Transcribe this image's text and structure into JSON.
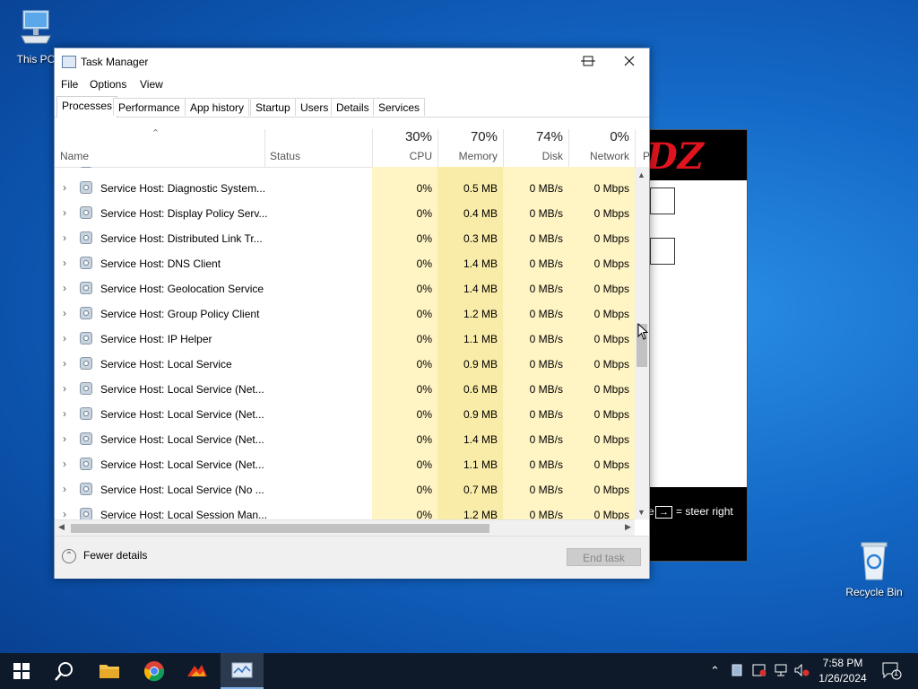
{
  "desktop": {
    "icons": [
      {
        "label": "This PC",
        "icon": "computer-icon"
      },
      {
        "label": "Recycle Bin",
        "icon": "recycle-bin-icon"
      }
    ]
  },
  "background_window": {
    "logo_text": "DZ",
    "hint_key": "→",
    "hint_text": "= steer right",
    "fragment": "e"
  },
  "task_manager": {
    "title": "Task Manager",
    "menu": [
      "File",
      "Options",
      "View"
    ],
    "tabs": [
      "Processes",
      "Performance",
      "App history",
      "Startup",
      "Users",
      "Details",
      "Services"
    ],
    "active_tab": "Processes",
    "columns": {
      "name": "Name",
      "status": "Status",
      "cpu": {
        "pct": "30%",
        "label": "CPU"
      },
      "memory": {
        "pct": "70%",
        "label": "Memory"
      },
      "disk": {
        "pct": "74%",
        "label": "Disk"
      },
      "network": {
        "pct": "0%",
        "label": "Network"
      },
      "power": "P"
    },
    "rows": [
      {
        "name": "Service Host: Diagnostic System...",
        "cpu": "0%",
        "memory": "0.5 MB",
        "disk": "0 MB/s",
        "network": "0 Mbps"
      },
      {
        "name": "Service Host: Display Policy Serv...",
        "cpu": "0%",
        "memory": "0.4 MB",
        "disk": "0 MB/s",
        "network": "0 Mbps"
      },
      {
        "name": "Service Host: Distributed Link Tr...",
        "cpu": "0%",
        "memory": "0.3 MB",
        "disk": "0 MB/s",
        "network": "0 Mbps"
      },
      {
        "name": "Service Host: DNS Client",
        "cpu": "0%",
        "memory": "1.4 MB",
        "disk": "0 MB/s",
        "network": "0 Mbps"
      },
      {
        "name": "Service Host: Geolocation Service",
        "cpu": "0%",
        "memory": "1.4 MB",
        "disk": "0 MB/s",
        "network": "0 Mbps"
      },
      {
        "name": "Service Host: Group Policy Client",
        "cpu": "0%",
        "memory": "1.2 MB",
        "disk": "0 MB/s",
        "network": "0 Mbps"
      },
      {
        "name": "Service Host: IP Helper",
        "cpu": "0%",
        "memory": "1.1 MB",
        "disk": "0 MB/s",
        "network": "0 Mbps"
      },
      {
        "name": "Service Host: Local Service",
        "cpu": "0%",
        "memory": "0.9 MB",
        "disk": "0 MB/s",
        "network": "0 Mbps"
      },
      {
        "name": "Service Host: Local Service (Net...",
        "cpu": "0%",
        "memory": "0.6 MB",
        "disk": "0 MB/s",
        "network": "0 Mbps"
      },
      {
        "name": "Service Host: Local Service (Net...",
        "cpu": "0%",
        "memory": "0.9 MB",
        "disk": "0 MB/s",
        "network": "0 Mbps"
      },
      {
        "name": "Service Host: Local Service (Net...",
        "cpu": "0%",
        "memory": "1.4 MB",
        "disk": "0 MB/s",
        "network": "0 Mbps"
      },
      {
        "name": "Service Host: Local Service (Net...",
        "cpu": "0%",
        "memory": "1.1 MB",
        "disk": "0 MB/s",
        "network": "0 Mbps"
      },
      {
        "name": "Service Host: Local Service (No ...",
        "cpu": "0%",
        "memory": "0.7 MB",
        "disk": "0 MB/s",
        "network": "0 Mbps"
      },
      {
        "name": "Service Host: Local Session Man...",
        "cpu": "0%",
        "memory": "1.2 MB",
        "disk": "0 MB/s",
        "network": "0 Mbps"
      }
    ],
    "footer": {
      "fewer_details": "Fewer details",
      "end_task": "End task"
    }
  },
  "taskbar": {
    "clock_time": "7:58 PM",
    "clock_date": "1/26/2024",
    "notification_count": "1"
  },
  "colors": {
    "heat_light": "#fff4c4",
    "heat_medium": "#f9eca8",
    "taskbar": "#0e1a2a"
  }
}
